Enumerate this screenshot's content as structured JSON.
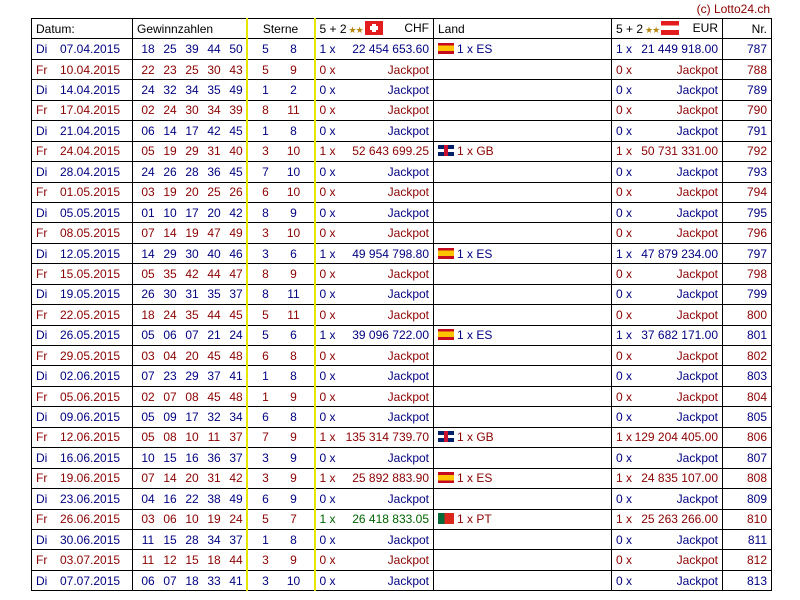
{
  "copyright": "(c) Lotto24.ch",
  "headers": {
    "datum": "Datum:",
    "gewinnzahlen": "Gewinnzahlen",
    "sterne": "Sterne",
    "chf_prefix": "5 + 2",
    "chf": "CHF",
    "land": "Land",
    "eur_prefix": "5 + 2",
    "eur": "EUR",
    "nr": "Nr."
  },
  "header_icons": {
    "chf_stars": "star-pair-icon",
    "chf_flag": "swiss-flag-icon",
    "eur_stars": "star-pair-icon",
    "eur_flag": "austrian-flag-icon"
  },
  "colors": {
    "tuesday": "#000080",
    "friday": "#8b0000",
    "sterne_border": "#e6e600"
  },
  "rows": [
    {
      "day": "Di",
      "date": "07.04.2015",
      "n": [
        "18",
        "25",
        "39",
        "44",
        "50"
      ],
      "s": [
        "5",
        "8"
      ],
      "chf_x": "1 x",
      "chf": "22 454 653.60",
      "land": "1 x ES",
      "flag": "es",
      "eur_x": "1 x",
      "eur": "21 449 918.00",
      "nr": "787"
    },
    {
      "day": "Fr",
      "date": "10.04.2015",
      "n": [
        "22",
        "23",
        "25",
        "30",
        "43"
      ],
      "s": [
        "5",
        "9"
      ],
      "chf_x": "0 x",
      "chf": "Jackpot",
      "land": "",
      "flag": "",
      "eur_x": "0 x",
      "eur": "Jackpot",
      "nr": "788"
    },
    {
      "day": "Di",
      "date": "14.04.2015",
      "n": [
        "24",
        "32",
        "34",
        "35",
        "49"
      ],
      "s": [
        "1",
        "2"
      ],
      "chf_x": "0 x",
      "chf": "Jackpot",
      "land": "",
      "flag": "",
      "eur_x": "0 x",
      "eur": "Jackpot",
      "nr": "789"
    },
    {
      "day": "Fr",
      "date": "17.04.2015",
      "n": [
        "02",
        "24",
        "30",
        "34",
        "39"
      ],
      "s": [
        "8",
        "11"
      ],
      "chf_x": "0 x",
      "chf": "Jackpot",
      "land": "",
      "flag": "",
      "eur_x": "0 x",
      "eur": "Jackpot",
      "nr": "790"
    },
    {
      "day": "Di",
      "date": "21.04.2015",
      "n": [
        "06",
        "14",
        "17",
        "42",
        "45"
      ],
      "s": [
        "1",
        "8"
      ],
      "chf_x": "0 x",
      "chf": "Jackpot",
      "land": "",
      "flag": "",
      "eur_x": "0 x",
      "eur": "Jackpot",
      "nr": "791"
    },
    {
      "day": "Fr",
      "date": "24.04.2015",
      "n": [
        "05",
        "19",
        "29",
        "31",
        "40"
      ],
      "s": [
        "3",
        "10"
      ],
      "chf_x": "1 x",
      "chf": "52 643 699.25",
      "land": "1 x GB",
      "flag": "gb",
      "eur_x": "1 x",
      "eur": "50 731 331.00",
      "nr": "792"
    },
    {
      "day": "Di",
      "date": "28.04.2015",
      "n": [
        "24",
        "26",
        "28",
        "36",
        "45"
      ],
      "s": [
        "7",
        "10"
      ],
      "chf_x": "0 x",
      "chf": "Jackpot",
      "land": "",
      "flag": "",
      "eur_x": "0 x",
      "eur": "Jackpot",
      "nr": "793"
    },
    {
      "day": "Fr",
      "date": "01.05.2015",
      "n": [
        "03",
        "19",
        "20",
        "25",
        "26"
      ],
      "s": [
        "6",
        "10"
      ],
      "chf_x": "0 x",
      "chf": "Jackpot",
      "land": "",
      "flag": "",
      "eur_x": "0 x",
      "eur": "Jackpot",
      "nr": "794"
    },
    {
      "day": "Di",
      "date": "05.05.2015",
      "n": [
        "01",
        "10",
        "17",
        "20",
        "42"
      ],
      "s": [
        "8",
        "9"
      ],
      "chf_x": "0 x",
      "chf": "Jackpot",
      "land": "",
      "flag": "",
      "eur_x": "0 x",
      "eur": "Jackpot",
      "nr": "795"
    },
    {
      "day": "Fr",
      "date": "08.05.2015",
      "n": [
        "07",
        "14",
        "19",
        "47",
        "49"
      ],
      "s": [
        "3",
        "10"
      ],
      "chf_x": "0 x",
      "chf": "Jackpot",
      "land": "",
      "flag": "",
      "eur_x": "0 x",
      "eur": "Jackpot",
      "nr": "796"
    },
    {
      "day": "Di",
      "date": "12.05.2015",
      "n": [
        "14",
        "29",
        "30",
        "40",
        "46"
      ],
      "s": [
        "3",
        "6"
      ],
      "chf_x": "1 x",
      "chf": "49 954 798.80",
      "land": "1 x ES",
      "flag": "es",
      "eur_x": "1 x",
      "eur": "47 879 234.00",
      "nr": "797"
    },
    {
      "day": "Fr",
      "date": "15.05.2015",
      "n": [
        "05",
        "35",
        "42",
        "44",
        "47"
      ],
      "s": [
        "8",
        "9"
      ],
      "chf_x": "0 x",
      "chf": "Jackpot",
      "land": "",
      "flag": "",
      "eur_x": "0 x",
      "eur": "Jackpot",
      "nr": "798"
    },
    {
      "day": "Di",
      "date": "19.05.2015",
      "n": [
        "26",
        "30",
        "31",
        "35",
        "37"
      ],
      "s": [
        "8",
        "11"
      ],
      "chf_x": "0 x",
      "chf": "Jackpot",
      "land": "",
      "flag": "",
      "eur_x": "0 x",
      "eur": "Jackpot",
      "nr": "799"
    },
    {
      "day": "Fr",
      "date": "22.05.2015",
      "n": [
        "18",
        "24",
        "35",
        "44",
        "45"
      ],
      "s": [
        "5",
        "11"
      ],
      "chf_x": "0 x",
      "chf": "Jackpot",
      "land": "",
      "flag": "",
      "eur_x": "0 x",
      "eur": "Jackpot",
      "nr": "800"
    },
    {
      "day": "Di",
      "date": "26.05.2015",
      "n": [
        "05",
        "06",
        "07",
        "21",
        "24"
      ],
      "s": [
        "5",
        "6"
      ],
      "chf_x": "1 x",
      "chf": "39 096 722.00",
      "land": "1 x ES",
      "flag": "es",
      "eur_x": "1 x",
      "eur": "37 682 171.00",
      "nr": "801"
    },
    {
      "day": "Fr",
      "date": "29.05.2015",
      "n": [
        "03",
        "04",
        "20",
        "45",
        "48"
      ],
      "s": [
        "6",
        "8"
      ],
      "chf_x": "0 x",
      "chf": "Jackpot",
      "land": "",
      "flag": "",
      "eur_x": "0 x",
      "eur": "Jackpot",
      "nr": "802"
    },
    {
      "day": "Di",
      "date": "02.06.2015",
      "n": [
        "07",
        "23",
        "29",
        "37",
        "41"
      ],
      "s": [
        "1",
        "8"
      ],
      "chf_x": "0 x",
      "chf": "Jackpot",
      "land": "",
      "flag": "",
      "eur_x": "0 x",
      "eur": "Jackpot",
      "nr": "803"
    },
    {
      "day": "Fr",
      "date": "05.06.2015",
      "n": [
        "02",
        "07",
        "08",
        "45",
        "48"
      ],
      "s": [
        "1",
        "9"
      ],
      "chf_x": "0 x",
      "chf": "Jackpot",
      "land": "",
      "flag": "",
      "eur_x": "0 x",
      "eur": "Jackpot",
      "nr": "804"
    },
    {
      "day": "Di",
      "date": "09.06.2015",
      "n": [
        "05",
        "09",
        "17",
        "32",
        "34"
      ],
      "s": [
        "6",
        "8"
      ],
      "chf_x": "0 x",
      "chf": "Jackpot",
      "land": "",
      "flag": "",
      "eur_x": "0 x",
      "eur": "Jackpot",
      "nr": "805"
    },
    {
      "day": "Fr",
      "date": "12.06.2015",
      "n": [
        "05",
        "08",
        "10",
        "11",
        "37"
      ],
      "s": [
        "7",
        "9"
      ],
      "chf_x": "1 x",
      "chf": "135 314 739.70",
      "land": "1 x GB",
      "flag": "gb",
      "eur_x": "1 x",
      "eur": "129 204 405.00",
      "nr": "806"
    },
    {
      "day": "Di",
      "date": "16.06.2015",
      "n": [
        "10",
        "15",
        "16",
        "36",
        "37"
      ],
      "s": [
        "3",
        "9"
      ],
      "chf_x": "0 x",
      "chf": "Jackpot",
      "land": "",
      "flag": "",
      "eur_x": "0 x",
      "eur": "Jackpot",
      "nr": "807"
    },
    {
      "day": "Fr",
      "date": "19.06.2015",
      "n": [
        "07",
        "14",
        "20",
        "31",
        "42"
      ],
      "s": [
        "3",
        "9"
      ],
      "chf_x": "1 x",
      "chf": "25 892 883.90",
      "land": "1 x ES",
      "flag": "es",
      "eur_x": "1 x",
      "eur": "24 835 107.00",
      "nr": "808"
    },
    {
      "day": "Di",
      "date": "23.06.2015",
      "n": [
        "04",
        "16",
        "22",
        "38",
        "49"
      ],
      "s": [
        "6",
        "9"
      ],
      "chf_x": "0 x",
      "chf": "Jackpot",
      "land": "",
      "flag": "",
      "eur_x": "0 x",
      "eur": "Jackpot",
      "nr": "809"
    },
    {
      "day": "Fr",
      "date": "26.06.2015",
      "n": [
        "03",
        "06",
        "10",
        "19",
        "24"
      ],
      "s": [
        "5",
        "7"
      ],
      "chf_x": "1 x",
      "chf": "26 418 833.05",
      "land": "1 x PT",
      "flag": "pt",
      "eur_x": "1 x",
      "eur": "25 263 266.00",
      "nr": "810"
    },
    {
      "day": "Di",
      "date": "30.06.2015",
      "n": [
        "11",
        "15",
        "28",
        "34",
        "37"
      ],
      "s": [
        "1",
        "8"
      ],
      "chf_x": "0 x",
      "chf": "Jackpot",
      "land": "",
      "flag": "",
      "eur_x": "0 x",
      "eur": "Jackpot",
      "nr": "811"
    },
    {
      "day": "Fr",
      "date": "03.07.2015",
      "n": [
        "11",
        "12",
        "15",
        "18",
        "44"
      ],
      "s": [
        "3",
        "9"
      ],
      "chf_x": "0 x",
      "chf": "Jackpot",
      "land": "",
      "flag": "",
      "eur_x": "0 x",
      "eur": "Jackpot",
      "nr": "812"
    },
    {
      "day": "Di",
      "date": "07.07.2015",
      "n": [
        "06",
        "07",
        "18",
        "33",
        "41"
      ],
      "s": [
        "3",
        "10"
      ],
      "chf_x": "0 x",
      "chf": "Jackpot",
      "land": "",
      "flag": "",
      "eur_x": "0 x",
      "eur": "Jackpot",
      "nr": "813"
    }
  ]
}
